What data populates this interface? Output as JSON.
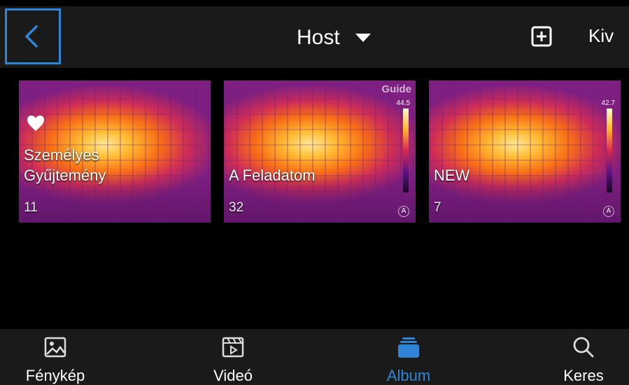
{
  "header": {
    "title": "Host",
    "select_label": "Kiv"
  },
  "albums": [
    {
      "name": "Személyes Gyűjtemény",
      "count": "11",
      "favorite": true,
      "bar_top": ""
    },
    {
      "name": "A Feladatom",
      "count": "32",
      "favorite": false,
      "logo": "Guide",
      "bar_top": "44.5"
    },
    {
      "name": "NEW",
      "count": "7",
      "favorite": false,
      "bar_top": "42.7"
    }
  ],
  "nav": [
    {
      "label": "Fénykép",
      "icon": "image-icon",
      "active": false
    },
    {
      "label": "Videó",
      "icon": "video-icon",
      "active": false
    },
    {
      "label": "Album",
      "icon": "album-icon",
      "active": true
    },
    {
      "label": "Keres",
      "icon": "search-icon",
      "active": false
    }
  ],
  "colors": {
    "accent": "#2f86d6",
    "bar_bg": "#1a1a1a",
    "background": "#000000"
  }
}
